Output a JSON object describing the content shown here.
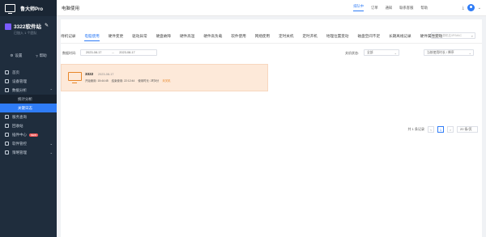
{
  "app": {
    "logo_text": "鲁大师Pro"
  },
  "company": {
    "name": "3322软件站",
    "sub": "已加入 1 个团队"
  },
  "sidebar": {
    "settings": "设置",
    "help": "帮助",
    "items": [
      {
        "label": "首页"
      },
      {
        "label": "设备管理"
      },
      {
        "label": "数据分析"
      },
      {
        "label": "统计分析"
      },
      {
        "label": "关键日志"
      },
      {
        "label": "服务查询"
      },
      {
        "label": "回收站"
      },
      {
        "label": "插件中心",
        "badge": "NEW"
      },
      {
        "label": "软件管控"
      },
      {
        "label": "策略管理"
      }
    ]
  },
  "topbar": {
    "page_title": "电脑使用",
    "links": [
      "排队中",
      "订单",
      "通知",
      "联系客服",
      "帮助"
    ]
  },
  "tabs": [
    "待机记录",
    "电脑使用",
    "硬件变更",
    "驱动异常",
    "硬盘故障",
    "硬件高温",
    "硬件高负载",
    "软件使用",
    "网络使用",
    "定时关机",
    "定时开机",
    "地理位置变动",
    "磁盘空间不足",
    "长期离线记录",
    "硬件属性变动"
  ],
  "search": {
    "placeholder": "搜索计算机名/IP/MAC"
  },
  "filters": {
    "date_label": "数据时间:",
    "date_start": "2023-08-17",
    "date_sep": "→",
    "date_end": "2023-08-17",
    "machine_label": "关机状态:",
    "machine_value": "全部",
    "sort_value": "当前使用时长 / 降序"
  },
  "card": {
    "title": "3322",
    "date": "2023-08-17",
    "boot": "开始使用: 15:44:45",
    "end": "结束使用: 22:12:44",
    "duration": "使用时长: 2时8分",
    "status": "未关机"
  },
  "pager": {
    "total": "共 1 条记录",
    "prev": "<",
    "page": "1",
    "next": ">",
    "size": "20 条/页"
  }
}
